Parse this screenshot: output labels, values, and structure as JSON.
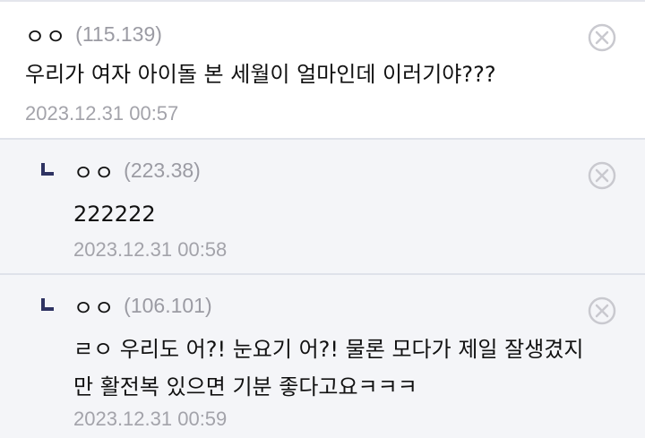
{
  "comments": [
    {
      "nickname": "ㅇㅇ",
      "ip": "(115.139)",
      "text": "우리가 여자 아이돌 본 세월이 얼마인데 이러기야???",
      "date": "2023.12.31 00:57"
    }
  ],
  "replies": [
    {
      "nickname": "ㅇㅇ",
      "ip": "(223.38)",
      "text_lines": [
        "222222"
      ],
      "date": "2023.12.31 00:58"
    },
    {
      "nickname": "ㅇㅇ",
      "ip": "(106.101)",
      "text_lines": [
        "ㄹㅇ 우리도 어?! 눈요기 어?! 물론 모다가 제일 잘생겼지",
        "만 활전복 있으면 기분 좋다고요ㅋㅋㅋ"
      ],
      "date": "2023.12.31 00:59"
    }
  ],
  "icons": {
    "delete": "delete-circle-x-icon",
    "reply": "reply-arrow-icon"
  },
  "colors": {
    "reply_bg": "#f4f5f8",
    "divider": "#dfe2ea",
    "meta": "#9b9ba3",
    "arrow": "#2e3362"
  }
}
